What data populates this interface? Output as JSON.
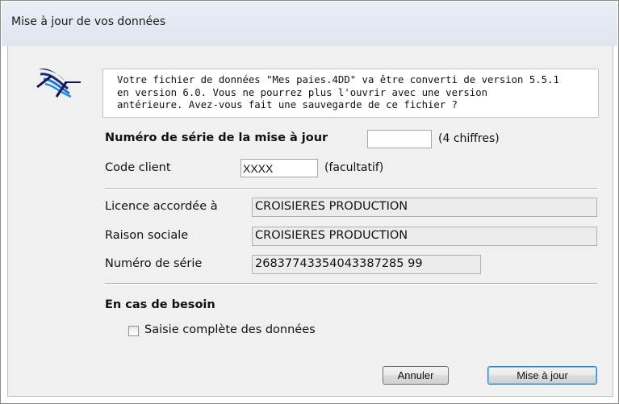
{
  "window": {
    "title": "Mise à jour de vos données"
  },
  "message": "Votre fichier de données \"Mes paies.4DD\" va être converti de version 5.5.1\nen version 6.0. Vous ne pourrez plus l'ouvrir avec une version\nantérieure. Avez-vous fait une sauvegarde de ce fichier ?",
  "form": {
    "serial_update_label": "Numéro de série de la mise à jour",
    "serial_update_value": "",
    "serial_update_hint": "(4 chiffres)",
    "client_code_label": "Code client",
    "client_code_value": "XXXX",
    "client_code_hint": "(facultatif)"
  },
  "license": {
    "granted_label": "Licence accordée à",
    "granted_value": "CROISIERES PRODUCTION",
    "company_label": "Raison sociale",
    "company_value": "CROISIERES PRODUCTION",
    "serial_label": "Numéro de série",
    "serial_value": "26837743354043387285 99"
  },
  "fallback": {
    "heading": "En cas de besoin",
    "checkbox_label": "Saisie complète des données",
    "checked": false
  },
  "buttons": {
    "cancel": "Annuler",
    "update": "Mise à jour"
  },
  "icons": {
    "logo": "chair-logo-icon"
  }
}
